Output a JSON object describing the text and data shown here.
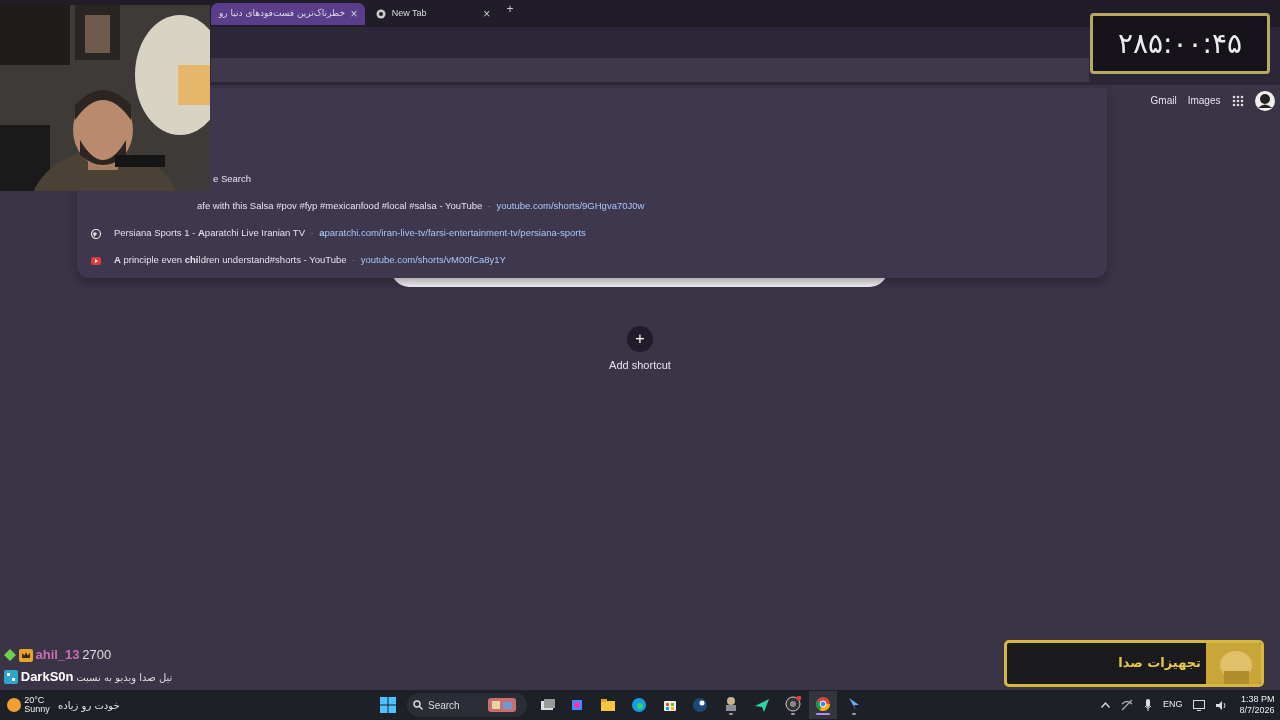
{
  "tabs": [
    {
      "label": "خطرناک‌ترین فست‌فودهای دنیا رو",
      "selected": true,
      "close": "×"
    },
    {
      "label": "New Tab",
      "selected": false,
      "close": "×"
    }
  ],
  "new_tab_button": "+",
  "header_links": [
    "Gmail",
    "Images"
  ],
  "omnibox": {
    "suggestions": [
      {
        "kind": "search",
        "title": "e Search"
      },
      {
        "kind": "page",
        "title": "afe with this Salsa #pov #fyp #mexicanfood #local #salsa - YouTube",
        "url": "youtube.com/shorts/9GHgva70J0w"
      },
      {
        "kind": "globe",
        "title": "Persiana Sports 1 - **A**paratchi Live Iranian TV",
        "url": "**a**paratchi.com/iran-live-tv/farsi-entertainment-tv/persiana-sports"
      },
      {
        "kind": "video",
        "title": "**A** principle even **chi**ldren understand#shorts - YouTube",
        "url": "youtube.com/shorts/vM00fCa8y1Y"
      }
    ],
    "separator": "-"
  },
  "shortcut": {
    "icon": "+",
    "label": "Add shortcut"
  },
  "overlay": {
    "clock": "۲۸۵:۰۰:۴۵",
    "banner": "تجهیزات صدا",
    "chat": [
      {
        "user": "ahil_13",
        "color": "#c86fb4",
        "text": "2700"
      },
      {
        "user": "DarkS0n",
        "color": "#ffffff",
        "text": "تیل صدا ویدیو به نسبت"
      }
    ],
    "chat_tail": "خودت رو زیاده"
  },
  "taskbar": {
    "weather": {
      "temp": "20°C",
      "desc": "Sunny"
    },
    "search": "Search",
    "apps": [
      {
        "kind": "taskview",
        "running": false,
        "focused": false
      },
      {
        "kind": "spark",
        "running": false,
        "focused": false
      },
      {
        "kind": "folder",
        "running": false,
        "focused": false
      },
      {
        "kind": "swirl",
        "running": false,
        "focused": false
      },
      {
        "kind": "bag",
        "running": false,
        "focused": false
      },
      {
        "kind": "steam",
        "running": false,
        "focused": false
      },
      {
        "kind": "figure",
        "running": true,
        "focused": false
      },
      {
        "kind": "plane",
        "running": false,
        "focused": false
      },
      {
        "kind": "camera",
        "running": true,
        "focused": false
      },
      {
        "kind": "chrome",
        "running": true,
        "focused": true
      },
      {
        "kind": "arrow",
        "running": true,
        "focused": false
      }
    ],
    "language": "ENG",
    "time": "1:38 PM",
    "date": "8/7/2026"
  }
}
